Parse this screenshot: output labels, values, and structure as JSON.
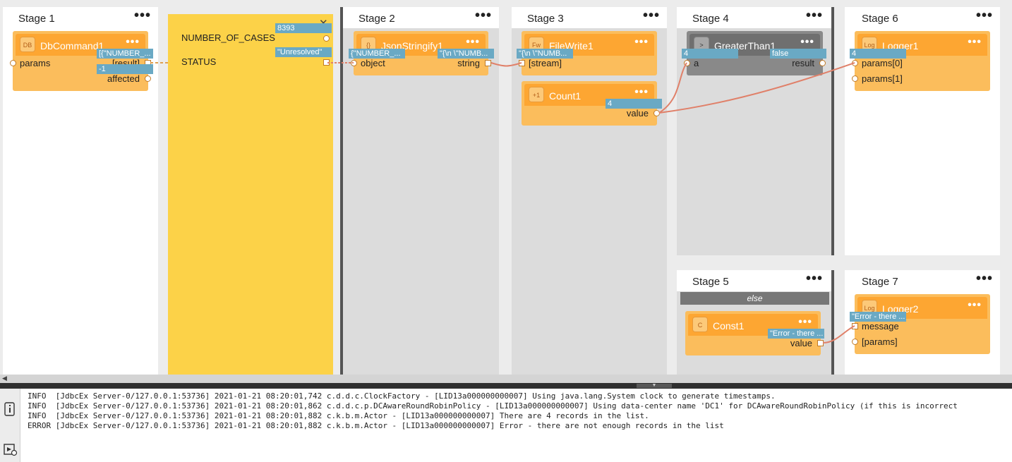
{
  "stages": {
    "stage1": {
      "title": "Stage 1",
      "menu": "•••"
    },
    "stage2": {
      "title": "Stage 2",
      "menu": "•••"
    },
    "stage3": {
      "title": "Stage 3",
      "menu": "•••"
    },
    "stage4": {
      "title": "Stage 4",
      "menu": "•••"
    },
    "stage5": {
      "title": "Stage 5",
      "menu": "•••",
      "else_label": "else"
    },
    "stage6": {
      "title": "Stage 6",
      "menu": "•••"
    },
    "stage7": {
      "title": "Stage 7",
      "menu": "•••"
    }
  },
  "nodes": {
    "dbcommand": {
      "icon": "DB",
      "title": "DbCommand1",
      "menu": "•••",
      "port_params": "params",
      "port_result": "[result]",
      "port_affected": "affected",
      "badge_result": "[{\"NUMBER_...",
      "badge_affected": "-1"
    },
    "json": {
      "icon": "{}",
      "title": "JsonStringify1",
      "menu": "•••",
      "port_object": "object",
      "port_string": "string",
      "badge_object": "{\"NUMBER_...",
      "badge_string": "\"{\\n  \\\"NUMB..."
    },
    "filewrite": {
      "icon": "Fw",
      "title": "FileWrite1",
      "menu": "•••",
      "port_stream": "[stream]",
      "badge_stream": "\"{\\n  \\\"NUMB..."
    },
    "count": {
      "icon": "+1",
      "title": "Count1",
      "menu": "•••",
      "port_value": "value",
      "badge_value": "4"
    },
    "greater": {
      "icon": ">",
      "title": "GreaterThan1",
      "menu": "•••",
      "port_a": "a",
      "port_result": "result",
      "badge_a": "4",
      "badge_result": "false"
    },
    "logger1": {
      "icon": "Log",
      "title": "Logger1",
      "menu": "•••",
      "port_p0": "params[0]",
      "port_p1": "params[1]",
      "badge_p0": "4"
    },
    "const": {
      "icon": "C",
      "title": "Const1",
      "menu": "•••",
      "port_value": "value",
      "badge_value": "\"Error - there ..."
    },
    "logger2": {
      "icon": "Log",
      "title": "Logger2",
      "menu": "•••",
      "port_message": "message",
      "port_params": "[params]",
      "badge_message": "\"Error - there ..."
    }
  },
  "inspector": {
    "field1": "NUMBER_OF_CASES",
    "field2": "STATUS",
    "value1": "8393",
    "value2": "\"Unresolved\"",
    "close": "✕"
  },
  "console": {
    "lines": [
      "INFO  [JdbcEx Server-0/127.0.0.1:53736] 2021-01-21 08:20:01,742 c.d.d.c.ClockFactory - [LID13a000000000007] Using java.lang.System clock to generate timestamps.",
      "INFO  [JdbcEx Server-0/127.0.0.1:53736] 2021-01-21 08:20:01,862 c.d.d.c.p.DCAwareRoundRobinPolicy - [LID13a000000000007] Using data-center name 'DC1' for DCAwareRoundRobinPolicy (if this is incorrect",
      "INFO  [JdbcEx Server-0/127.0.0.1:53736] 2021-01-21 08:20:01,882 c.k.b.m.Actor - [LID13a000000000007] There are 4 records in the list.",
      "ERROR [JdbcEx Server-0/127.0.0.1:53736] 2021-01-21 08:20:01,882 c.k.b.m.Actor - [LID13a000000000007] Error - there are not enough records in the list"
    ]
  },
  "colors": {
    "node_body": "#fbbd5c",
    "node_header": "#fda632",
    "badge": "#6aa9c4",
    "inspector": "#fcd248",
    "link": "#e08069",
    "grey_node": "#898989"
  },
  "icons": {
    "scroll_left": "triangle-left-icon",
    "splitter": "chevron-down-icon",
    "side1": "info-icon",
    "side2": "run-icon"
  }
}
